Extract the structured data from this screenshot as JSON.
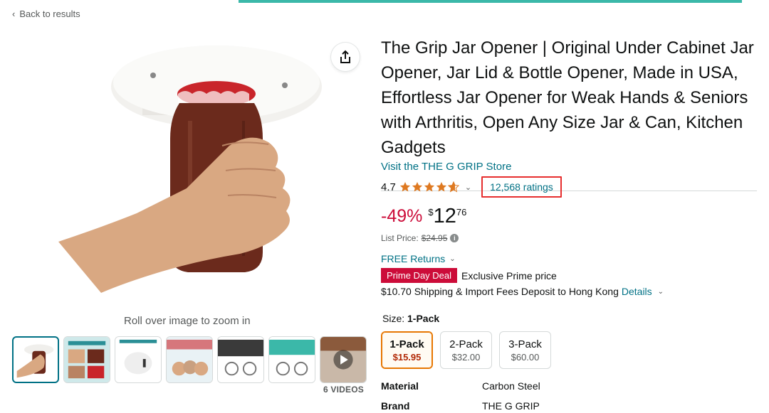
{
  "nav": {
    "back_label": "Back to results",
    "back_chevron": "‹"
  },
  "gallery": {
    "zoom_hint": "Roll over image to zoom in",
    "videos_label": "6 VIDEOS",
    "thumbnails": [
      "jar-opener-main",
      "effortlessly-open-jars",
      "jar-opener-installed",
      "made-in-the-usa",
      "how-to-use",
      "how-to-install",
      "video"
    ]
  },
  "product": {
    "title": "The Grip Jar Opener | Original Under Cabinet Jar Opener, Jar Lid & Bottle Opener, Made in USA, Effortless Jar Opener for Weak Hands & Seniors with Arthritis, Open Any Size Jar & Can, Kitchen Gadgets",
    "store_link": "Visit the THE G GRIP Store",
    "rating": "4.7",
    "rating_value": 4.7,
    "ratings_count": "12,568 ratings",
    "discount": "-49%",
    "price_symbol": "$",
    "price_whole": "12",
    "price_fraction": "76",
    "list_price_label": "List Price:",
    "list_price": "$24.95",
    "free_returns": "FREE Returns",
    "deal_badge": "Prime Day Deal",
    "deal_text": "Exclusive Prime price",
    "shipping_text": "$10.70 Shipping & Import Fees Deposit to Hong Kong",
    "shipping_details": "Details",
    "size_label": "Size:",
    "size_selected": "1-Pack",
    "sizes": [
      {
        "name": "1-Pack",
        "price": "$15.95"
      },
      {
        "name": "2-Pack",
        "price": "$32.00"
      },
      {
        "name": "3-Pack",
        "price": "$60.00"
      }
    ],
    "attributes": [
      {
        "label": "Material",
        "value": "Carbon Steel"
      },
      {
        "label": "Brand",
        "value": "THE G GRIP"
      }
    ]
  },
  "colors": {
    "link": "#007185",
    "deal": "#cc0c39",
    "star": "#de7921",
    "highlight_box": "#e62e2e",
    "top_strip": "#3bb8a9"
  }
}
